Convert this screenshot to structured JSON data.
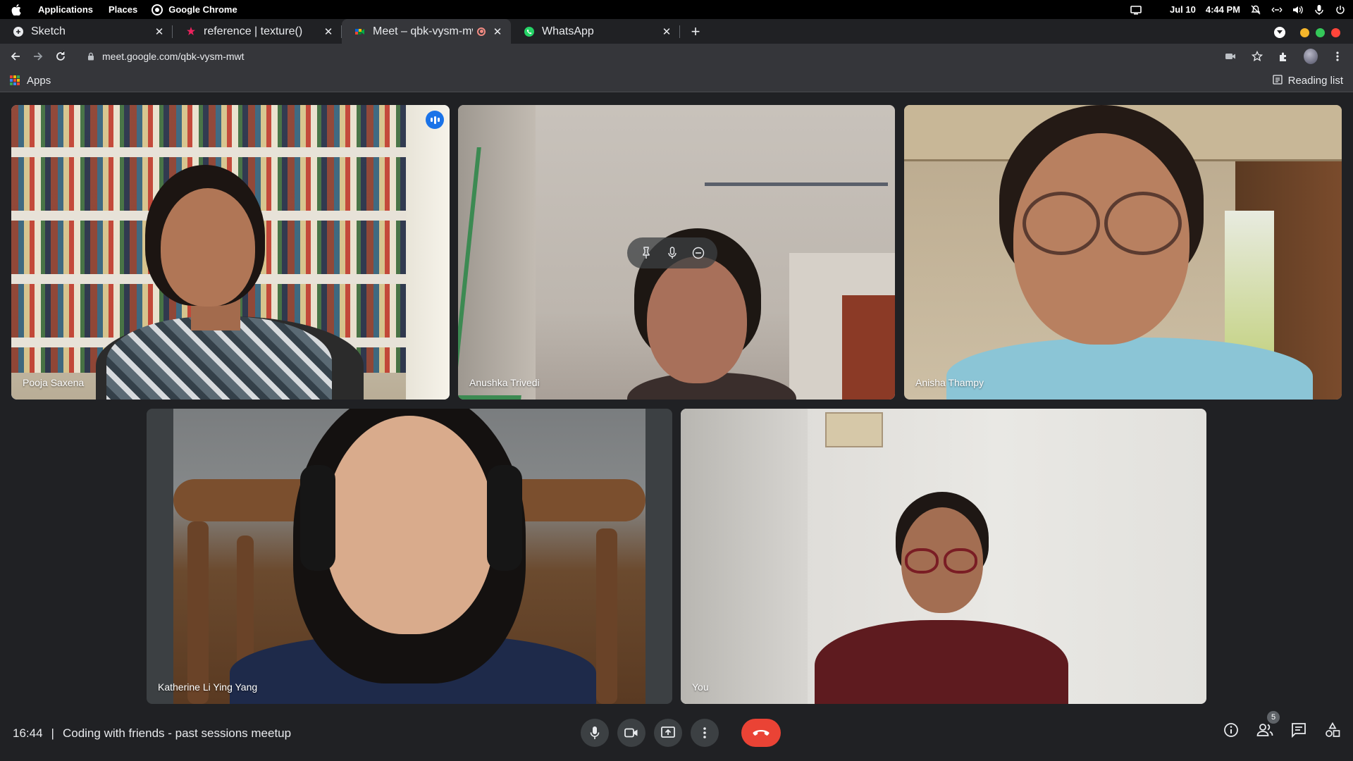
{
  "os": {
    "menus": [
      "Applications",
      "Places"
    ],
    "app_name": "Google Chrome",
    "date": "Jul 10",
    "time": "4:44 PM"
  },
  "tabs": [
    {
      "label": "Sketch",
      "favicon": "sketch-icon"
    },
    {
      "label": "reference | texture()",
      "favicon": "p5-star-icon"
    },
    {
      "label": "Meet – qbk-vysm-mw",
      "favicon": "meet-icon",
      "active": true,
      "recording": true
    },
    {
      "label": "WhatsApp",
      "favicon": "whatsapp-icon"
    }
  ],
  "omnibox": {
    "url": "meet.google.com/qbk-vysm-mwt"
  },
  "bookmarks": {
    "apps_label": "Apps",
    "reading_list_label": "Reading list"
  },
  "participants": [
    {
      "name": "Pooja Saxena",
      "speaking": true
    },
    {
      "name": "Anushka Trivedi"
    },
    {
      "name": "Anisha Thampy"
    },
    {
      "name": "Katherine Li Ying Yang"
    },
    {
      "name": "You"
    }
  ],
  "meeting": {
    "time": "16:44",
    "separator": "|",
    "title": "Coding with friends - past sessions meetup",
    "participant_count": "5"
  },
  "colors": {
    "accent_blue": "#8ab4f8",
    "end_call_red": "#ea4335",
    "background": "#202124"
  }
}
